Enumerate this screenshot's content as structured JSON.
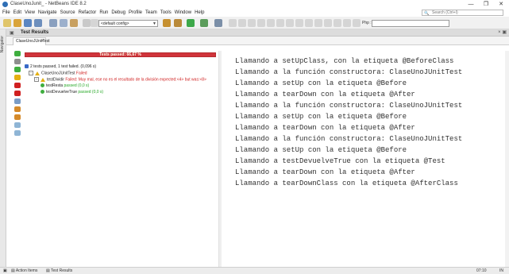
{
  "window": {
    "title": "ClaseUnoJunit_ - NetBeans IDE 8.2",
    "minimize": "—",
    "maximize": "❐",
    "close": "✕"
  },
  "menu": [
    "File",
    "Edit",
    "View",
    "Navigate",
    "Source",
    "Refactor",
    "Run",
    "Debug",
    "Profile",
    "Team",
    "Tools",
    "Window",
    "Help"
  ],
  "search": {
    "placeholder": "Search (Ctrl+I)"
  },
  "toolbar": {
    "config_value": "<default config>",
    "php_label": "Php :",
    "php_value": ""
  },
  "left_strip": {
    "navigator": "Navigator"
  },
  "panel": {
    "title": "Test Results",
    "tab": "ClaseUnoJUnitTest",
    "progress_label": "Tests passed: 66,67 %",
    "progress_pct": 66.67
  },
  "tree": {
    "summary": "2 tests passed, 1 test failed. (0,096 s)",
    "suite": {
      "name": "ClaseUnoJUnitTest",
      "status": "Failed"
    },
    "tests": [
      {
        "name": "testDividir",
        "status": "Failed: Muy mal, ese no es el resultado de la división expected:<4> but was:<8>"
      },
      {
        "name": "testResta",
        "status": "passed (0,0 s)"
      },
      {
        "name": "testDevuelveTrue",
        "status": "passed (0,0 s)"
      }
    ]
  },
  "output_lines": [
    "Llamando a setUpClass, con la etiqueta @BeforeClass",
    "Llamando a la función constructora: ClaseUnoJUnitTest",
    "Llamando a setUp con la etiqueta @Before",
    "Llamando a tearDown con la etiqueta @After",
    "Llamando a la función constructora: ClaseUnoJUnitTest",
    "Llamando a setUp con la etiqueta @Before",
    "Llamando a tearDown con la etiqueta @After",
    "Llamando a la función constructora: ClaseUnoJUnitTest",
    "Llamando a setUp con la etiqueta @Before",
    "Llamando a testDevuelveTrue con la etiqueta @Test",
    "Llamando a tearDown con la etiqueta @After",
    "Llamando a tearDownClass con la etiqueta @AfterClass"
  ],
  "status": {
    "action_items": "Action Items",
    "test_results": "Test Results",
    "position": "07:10",
    "ins": "IN"
  }
}
